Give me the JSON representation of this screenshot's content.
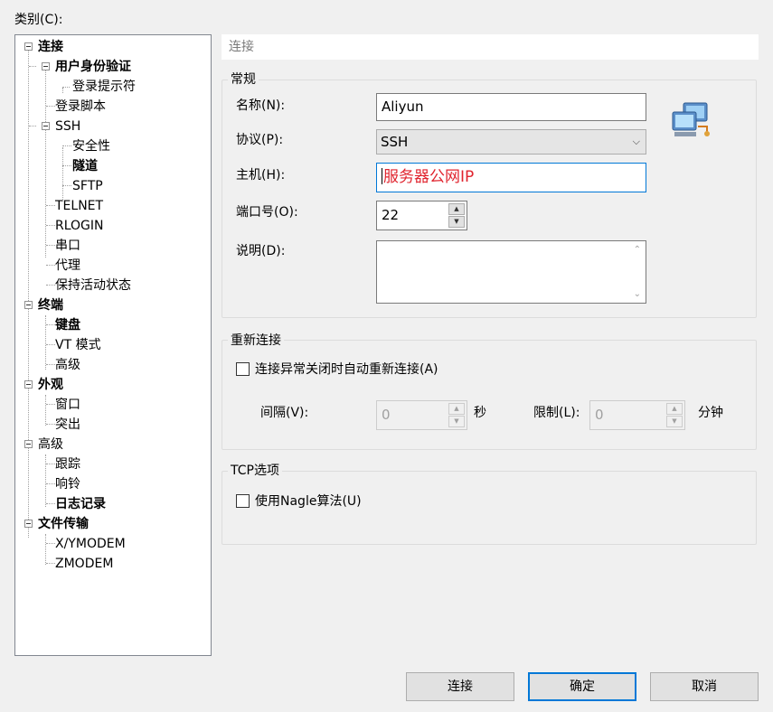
{
  "dialog": {
    "category_label": "类别(C):"
  },
  "tree": {
    "items": [
      {
        "label": "连接",
        "bold": true
      },
      {
        "label": "用户身份验证",
        "bold": true
      },
      {
        "label": "登录提示符",
        "bold": false
      },
      {
        "label": "登录脚本",
        "bold": false
      },
      {
        "label": "SSH",
        "bold": false
      },
      {
        "label": "安全性",
        "bold": false
      },
      {
        "label": "隧道",
        "bold": true
      },
      {
        "label": "SFTP",
        "bold": false
      },
      {
        "label": "TELNET",
        "bold": false
      },
      {
        "label": "RLOGIN",
        "bold": false
      },
      {
        "label": "串口",
        "bold": false
      },
      {
        "label": "代理",
        "bold": false
      },
      {
        "label": "保持活动状态",
        "bold": false
      },
      {
        "label": "终端",
        "bold": true
      },
      {
        "label": "键盘",
        "bold": true
      },
      {
        "label": "VT 模式",
        "bold": false
      },
      {
        "label": "高级",
        "bold": false
      },
      {
        "label": "外观",
        "bold": true
      },
      {
        "label": "窗口",
        "bold": false
      },
      {
        "label": "突出",
        "bold": false
      },
      {
        "label": "高级",
        "bold": false
      },
      {
        "label": "跟踪",
        "bold": false
      },
      {
        "label": "响铃",
        "bold": false
      },
      {
        "label": "日志记录",
        "bold": true
      },
      {
        "label": "文件传输",
        "bold": true
      },
      {
        "label": "X/YMODEM",
        "bold": false
      },
      {
        "label": "ZMODEM",
        "bold": false
      }
    ]
  },
  "panel": {
    "title": "连接",
    "general": {
      "title": "常规",
      "name_label": "名称(N):",
      "name_value": "Aliyun",
      "protocol_label": "协议(P):",
      "protocol_value": "SSH",
      "host_label": "主机(H):",
      "host_value": "服务器公网IP",
      "port_label": "端口号(O):",
      "port_value": "22",
      "desc_label": "说明(D):",
      "desc_value": "",
      "icon": "network-computers-icon"
    },
    "reconnect": {
      "title": "重新连接",
      "checkbox_label": "连接异常关闭时自动重新连接(A)",
      "checked": false,
      "interval_label": "间隔(V):",
      "interval_value": "0",
      "interval_unit": "秒",
      "limit_label": "限制(L):",
      "limit_value": "0",
      "limit_unit": "分钟"
    },
    "tcp": {
      "title": "TCP选项",
      "nagle_label": "使用Nagle算法(U)",
      "checked": false
    }
  },
  "buttons": {
    "connect": "连接",
    "ok": "确定",
    "cancel": "取消"
  },
  "colors": {
    "accent": "#0078d7",
    "host_text": "#e0242e"
  }
}
